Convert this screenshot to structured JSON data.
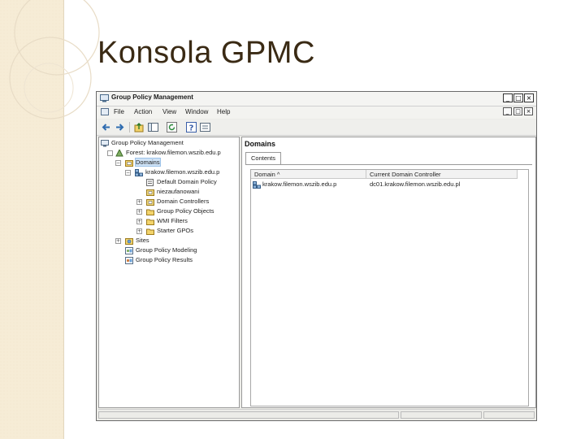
{
  "slide": {
    "title": "Konsola GPMC"
  },
  "window": {
    "title": "Group Policy Management",
    "controls": [
      "_",
      "□",
      "×"
    ],
    "mdi_controls": [
      "_",
      "□",
      "×"
    ],
    "menu": [
      "File",
      "Action",
      "View",
      "Window",
      "Help"
    ],
    "toolbar_icons": [
      "back-icon",
      "forward-icon",
      "up-icon",
      "show-hide-tree-icon",
      "refresh-icon",
      "help-icon",
      "properties-icon"
    ]
  },
  "tree": {
    "nodes": [
      {
        "label": "Group Policy Management",
        "expander": "",
        "icon": "gpm-icon"
      },
      {
        "label": "Forest: krakow.filemon.wszib.edu.p",
        "expander": "",
        "icon": "forest-icon"
      },
      {
        "label": "Domains",
        "expander": "−",
        "icon": "domains-folder-icon",
        "selected": true
      },
      {
        "label": "krakow.filemon.wszib.edu.p",
        "expander": "−",
        "icon": "domain-icon"
      },
      {
        "label": "Default Domain Policy",
        "expander": "",
        "icon": "gpo-link-icon"
      },
      {
        "label": "niezaufanowani",
        "expander": "",
        "icon": "ou-icon"
      },
      {
        "label": "Domain Controllers",
        "expander": "+",
        "icon": "ou-icon"
      },
      {
        "label": "Group Policy Objects",
        "expander": "+",
        "icon": "folder-icon"
      },
      {
        "label": "WMI Filters",
        "expander": "+",
        "icon": "folder-icon"
      },
      {
        "label": "Starter GPOs",
        "expander": "+",
        "icon": "folder-icon"
      },
      {
        "label": "Sites",
        "expander": "+",
        "icon": "sites-icon"
      },
      {
        "label": "Group Policy Modeling",
        "expander": "",
        "icon": "modeling-icon"
      },
      {
        "label": "Group Policy Results",
        "expander": "",
        "icon": "results-icon"
      }
    ]
  },
  "details": {
    "heading": "Domains",
    "tab": "Contents",
    "columns": [
      "Domain ^",
      "Current Domain Controller"
    ],
    "rows": [
      {
        "domain": "krakow.filemon.wszib.edu.p",
        "controller": "dc01.krakow.filemon.wszib.edu.pl"
      }
    ]
  },
  "colors": {
    "title_text": "#3a2a14",
    "deco_stripe": "#f6ecd6",
    "selection": "#cfe3f7"
  }
}
